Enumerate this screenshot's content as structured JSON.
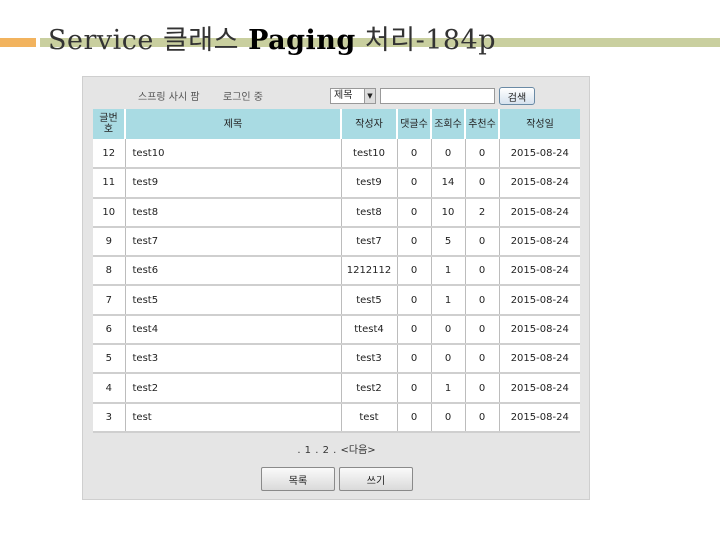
{
  "slide": {
    "title_prefix": "Service 클래스",
    "title_bold": "Paging",
    "title_suffix": "처리-184p"
  },
  "topbar": {
    "user_info": "스프링 사시 팜",
    "visit_info": "로그인 중",
    "search_select_value": "제목",
    "search_input_value": "",
    "search_button": "검색"
  },
  "table": {
    "headers": [
      "글번호",
      "제목",
      "작성자",
      "댓글수",
      "조회수",
      "추천수",
      "작성일"
    ],
    "rows": [
      {
        "no": "12",
        "subject": "test10",
        "writer": "test10",
        "reply": "0",
        "views": "0",
        "recommend": "0",
        "date": "2015-08-24"
      },
      {
        "no": "11",
        "subject": "test9",
        "writer": "test9",
        "reply": "0",
        "views": "14",
        "recommend": "0",
        "date": "2015-08-24"
      },
      {
        "no": "10",
        "subject": "test8",
        "writer": "test8",
        "reply": "0",
        "views": "10",
        "recommend": "2",
        "date": "2015-08-24"
      },
      {
        "no": "9",
        "subject": "test7",
        "writer": "test7",
        "reply": "0",
        "views": "5",
        "recommend": "0",
        "date": "2015-08-24"
      },
      {
        "no": "8",
        "subject": "test6",
        "writer": "1212112",
        "reply": "0",
        "views": "1",
        "recommend": "0",
        "date": "2015-08-24"
      },
      {
        "no": "7",
        "subject": "test5",
        "writer": "test5",
        "reply": "0",
        "views": "1",
        "recommend": "0",
        "date": "2015-08-24"
      },
      {
        "no": "6",
        "subject": "test4",
        "writer": "ttest4",
        "reply": "0",
        "views": "0",
        "recommend": "0",
        "date": "2015-08-24"
      },
      {
        "no": "5",
        "subject": "test3",
        "writer": "test3",
        "reply": "0",
        "views": "0",
        "recommend": "0",
        "date": "2015-08-24"
      },
      {
        "no": "4",
        "subject": "test2",
        "writer": "test2",
        "reply": "0",
        "views": "1",
        "recommend": "0",
        "date": "2015-08-24"
      },
      {
        "no": "3",
        "subject": "test",
        "writer": "test",
        "reply": "0",
        "views": "0",
        "recommend": "0",
        "date": "2015-08-24"
      }
    ]
  },
  "pagination": {
    "pages": [
      "1",
      "2"
    ],
    "next_label": "<다음>"
  },
  "buttons": {
    "list": "목록",
    "write": "쓰기"
  },
  "colors": {
    "header_bg": "#a9dbe3",
    "panel_bg": "#e5e5e5",
    "accent_orange": "#f2b35e",
    "accent_olive": "#c9cf9f"
  }
}
